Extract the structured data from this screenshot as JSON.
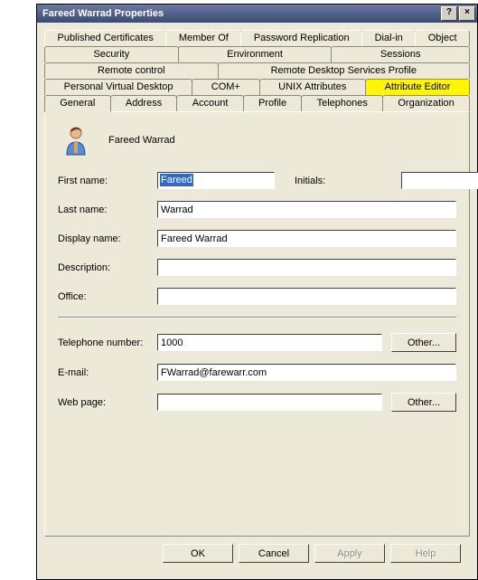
{
  "window": {
    "title": "Fareed Warrad Properties",
    "help_label": "?",
    "close_label": "×"
  },
  "tabs": {
    "row1": [
      "Published Certificates",
      "Member Of",
      "Password Replication",
      "Dial-in",
      "Object"
    ],
    "row2": [
      "Security",
      "Environment",
      "Sessions"
    ],
    "row3": [
      "Remote control",
      "Remote Desktop Services Profile"
    ],
    "row4": [
      "Personal Virtual Desktop",
      "COM+",
      "UNIX Attributes",
      "Attribute Editor"
    ],
    "row5": [
      "General",
      "Address",
      "Account",
      "Profile",
      "Telephones",
      "Organization"
    ],
    "active": "General",
    "highlighted": "Attribute Editor"
  },
  "general": {
    "display_heading": "Fareed Warrad",
    "first_name_label": "First name:",
    "first_name_value": "Fareed",
    "initials_label": "Initials:",
    "initials_value": "",
    "last_name_label": "Last name:",
    "last_name_value": "Warrad",
    "display_name_label": "Display name:",
    "display_name_value": "Fareed Warrad",
    "description_label": "Description:",
    "description_value": "",
    "office_label": "Office:",
    "office_value": "",
    "telephone_label": "Telephone number:",
    "telephone_value": "1000",
    "telephone_other": "Other...",
    "email_label": "E-mail:",
    "email_value": "FWarrad@farewarr.com",
    "webpage_label": "Web page:",
    "webpage_value": "",
    "webpage_other": "Other..."
  },
  "buttons": {
    "ok": "OK",
    "cancel": "Cancel",
    "apply": "Apply",
    "help": "Help"
  }
}
